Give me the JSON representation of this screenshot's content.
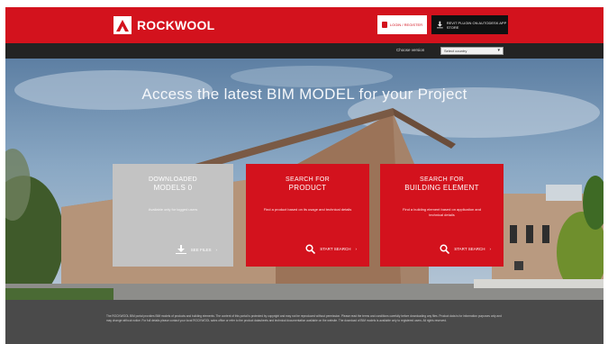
{
  "header": {
    "brand": "ROCKWOOL",
    "login_label": "LOGIN / REGISTER",
    "autodesk_label": "REVIT PLUGIN ON AUTODESK APP STORE"
  },
  "country": {
    "label": "Choose version",
    "selected": "Select country"
  },
  "hero": {
    "title": "Access the latest BIM MODEL for your Project"
  },
  "cards": [
    {
      "title_line1": "DOWNLOADED",
      "title_line2": "MODELS 0",
      "description": "Available only for logged users",
      "action": "SEE FILES"
    },
    {
      "title_line1": "SEARCH FOR",
      "title_line2": "PRODUCT",
      "description": "Find a product based on its usage and technical details",
      "action": "START SEARCH"
    },
    {
      "title_line1": "SEARCH FOR",
      "title_line2": "BUILDING ELEMENT",
      "description": "Find a building element based on application and technical details",
      "action": "START SEARCH"
    }
  ],
  "footer": {
    "text": "The ROCKWOOL BIM portal provides BIM models of products and building elements. The content of this portal is protected by copyright and may not be reproduced without permission. Please read the terms and conditions carefully before downloading any files. Product data is for information purposes only and may change without notice. For full details please contact your local ROCKWOOL sales office or refer to the product datasheets and technical documentation available on the website. The download of BIM models is available only to registered users. All rights reserved."
  },
  "colors": {
    "brand_red": "#d3121d",
    "dark_bar": "#232323",
    "card_grey": "#c3c3c3",
    "footer_grey": "#4a4a4a"
  }
}
